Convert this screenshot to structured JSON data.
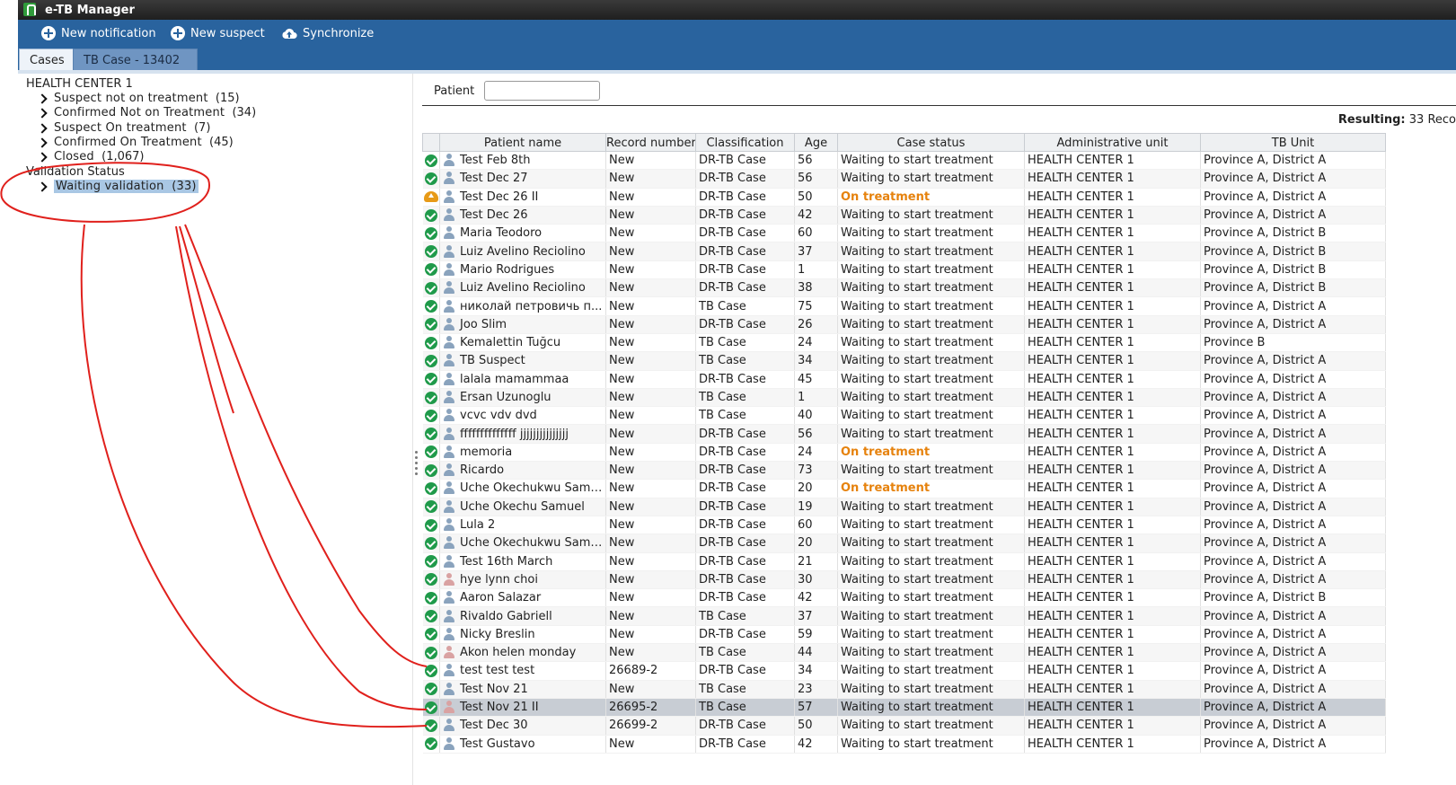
{
  "window": {
    "title": "e-TB Manager"
  },
  "toolbar": {
    "new_notification": "New notification",
    "new_suspect": "New suspect",
    "synchronize": "Synchronize"
  },
  "tabs": [
    {
      "label": "Cases",
      "active": true
    },
    {
      "label": "TB Case - 13402",
      "active": false
    }
  ],
  "tree": {
    "root": "HEALTH CENTER 1",
    "items": [
      {
        "label": "Suspect not on treatment",
        "count": "(15)"
      },
      {
        "label": "Confirmed Not on Treatment",
        "count": "(34)"
      },
      {
        "label": "Suspect On treatment",
        "count": "(7)"
      },
      {
        "label": "Confirmed On Treatment",
        "count": "(45)"
      },
      {
        "label": "Closed",
        "count": "(1,067)"
      }
    ],
    "group": "Validation Status",
    "group_items": [
      {
        "label": "Waiting validation",
        "count": "(33)",
        "selected": true
      }
    ]
  },
  "search": {
    "label": "Patient",
    "value": ""
  },
  "resulting": {
    "label": "Resulting:",
    "value": "33 Reco"
  },
  "grid": {
    "columns": [
      "",
      "Patient name",
      "Record number",
      "Classification",
      "Age",
      "Case status",
      "Administrative unit",
      "TB Unit"
    ],
    "rows": [
      {
        "icon": "check-icon",
        "gender": "male",
        "name": "Test Feb 8th",
        "record": "New",
        "classification": "DR-TB Case",
        "age": "56",
        "status": "Waiting to start treatment",
        "admin_unit": "HEALTH CENTER 1",
        "tb_unit": "Province A, District A"
      },
      {
        "icon": "check-icon",
        "gender": "male",
        "name": "Test Dec 27",
        "record": "New",
        "classification": "DR-TB Case",
        "age": "56",
        "status": "Waiting to start treatment",
        "admin_unit": "HEALTH CENTER 1",
        "tb_unit": "Province A, District A"
      },
      {
        "icon": "upload-icon",
        "gender": "male",
        "name": "Test Dec 26 II",
        "record": "New",
        "classification": "DR-TB Case",
        "age": "50",
        "status": "On treatment",
        "admin_unit": "HEALTH CENTER 1",
        "tb_unit": "Province A, District A"
      },
      {
        "icon": "check-icon",
        "gender": "male",
        "name": "Test Dec 26",
        "record": "New",
        "classification": "DR-TB Case",
        "age": "42",
        "status": "Waiting to start treatment",
        "admin_unit": "HEALTH CENTER 1",
        "tb_unit": "Province A, District A"
      },
      {
        "icon": "check-icon",
        "gender": "male",
        "name": "Maria Teodoro",
        "record": "New",
        "classification": "DR-TB Case",
        "age": "60",
        "status": "Waiting to start treatment",
        "admin_unit": "HEALTH CENTER 1",
        "tb_unit": "Province A, District B"
      },
      {
        "icon": "check-icon",
        "gender": "male",
        "name": "Luiz Avelino Reciolino",
        "record": "New",
        "classification": "DR-TB Case",
        "age": "37",
        "status": "Waiting to start treatment",
        "admin_unit": "HEALTH CENTER 1",
        "tb_unit": "Province A, District B"
      },
      {
        "icon": "check-icon",
        "gender": "male",
        "name": "Mario Rodrigues",
        "record": "New",
        "classification": "DR-TB Case",
        "age": "1",
        "status": "Waiting to start treatment",
        "admin_unit": "HEALTH CENTER 1",
        "tb_unit": "Province A, District B"
      },
      {
        "icon": "check-icon",
        "gender": "male",
        "name": "Luiz Avelino Reciolino",
        "record": "New",
        "classification": "DR-TB Case",
        "age": "38",
        "status": "Waiting to start treatment",
        "admin_unit": "HEALTH CENTER 1",
        "tb_unit": "Province A, District B"
      },
      {
        "icon": "check-icon",
        "gender": "male",
        "name": "николай петровичь п...",
        "record": "New",
        "classification": "TB Case",
        "age": "75",
        "status": "Waiting to start treatment",
        "admin_unit": "HEALTH CENTER 1",
        "tb_unit": "Province A, District A"
      },
      {
        "icon": "check-icon",
        "gender": "male",
        "name": "Joo Slim",
        "record": "New",
        "classification": "DR-TB Case",
        "age": "26",
        "status": "Waiting to start treatment",
        "admin_unit": "HEALTH CENTER 1",
        "tb_unit": "Province A, District A"
      },
      {
        "icon": "check-icon",
        "gender": "male",
        "name": "Kemalettin Tuğcu",
        "record": "New",
        "classification": "TB Case",
        "age": "24",
        "status": "Waiting to start treatment",
        "admin_unit": "HEALTH CENTER 1",
        "tb_unit": "Province B"
      },
      {
        "icon": "check-icon",
        "gender": "male",
        "name": "TB Suspect",
        "record": "New",
        "classification": "TB Case",
        "age": "34",
        "status": "Waiting to start treatment",
        "admin_unit": "HEALTH CENTER 1",
        "tb_unit": "Province A, District A"
      },
      {
        "icon": "check-icon",
        "gender": "male",
        "name": "lalala mamammaa",
        "record": "New",
        "classification": "DR-TB Case",
        "age": "45",
        "status": "Waiting to start treatment",
        "admin_unit": "HEALTH CENTER 1",
        "tb_unit": "Province A, District A"
      },
      {
        "icon": "check-icon",
        "gender": "male",
        "name": "Ersan Uzunoglu",
        "record": "New",
        "classification": "TB Case",
        "age": "1",
        "status": "Waiting to start treatment",
        "admin_unit": "HEALTH CENTER 1",
        "tb_unit": "Province A, District A"
      },
      {
        "icon": "check-icon",
        "gender": "male",
        "name": "vcvc vdv dvd",
        "record": "New",
        "classification": "TB Case",
        "age": "40",
        "status": "Waiting to start treatment",
        "admin_unit": "HEALTH CENTER 1",
        "tb_unit": "Province A, District A"
      },
      {
        "icon": "check-icon",
        "gender": "male",
        "name": "ffffffffffffff jjjjjjjjjjjjjjj",
        "record": "New",
        "classification": "DR-TB Case",
        "age": "56",
        "status": "Waiting to start treatment",
        "admin_unit": "HEALTH CENTER 1",
        "tb_unit": "Province A, District A"
      },
      {
        "icon": "check-icon",
        "gender": "male",
        "name": "memoria",
        "record": "New",
        "classification": "DR-TB Case",
        "age": "24",
        "status": "On treatment",
        "admin_unit": "HEALTH CENTER 1",
        "tb_unit": "Province A, District A"
      },
      {
        "icon": "check-icon",
        "gender": "male",
        "name": "Ricardo",
        "record": "New",
        "classification": "DR-TB Case",
        "age": "73",
        "status": "Waiting to start treatment",
        "admin_unit": "HEALTH CENTER 1",
        "tb_unit": "Province A, District A"
      },
      {
        "icon": "check-icon",
        "gender": "male",
        "name": "Uche Okechukwu Samuel",
        "record": "New",
        "classification": "DR-TB Case",
        "age": "20",
        "status": "On treatment",
        "admin_unit": "HEALTH CENTER 1",
        "tb_unit": "Province A, District A"
      },
      {
        "icon": "check-icon",
        "gender": "male",
        "name": "Uche Okechu Samuel",
        "record": "New",
        "classification": "DR-TB Case",
        "age": "19",
        "status": "Waiting to start treatment",
        "admin_unit": "HEALTH CENTER 1",
        "tb_unit": "Province A, District A"
      },
      {
        "icon": "check-icon",
        "gender": "male",
        "name": "Lula 2",
        "record": "New",
        "classification": "DR-TB Case",
        "age": "60",
        "status": "Waiting to start treatment",
        "admin_unit": "HEALTH CENTER 1",
        "tb_unit": "Province A, District A"
      },
      {
        "icon": "check-icon",
        "gender": "male",
        "name": "Uche Okechukwu Samuel",
        "record": "New",
        "classification": "DR-TB Case",
        "age": "20",
        "status": "Waiting to start treatment",
        "admin_unit": "HEALTH CENTER 1",
        "tb_unit": "Province A, District A"
      },
      {
        "icon": "check-icon",
        "gender": "male",
        "name": "Test 16th March",
        "record": "New",
        "classification": "DR-TB Case",
        "age": "21",
        "status": "Waiting to start treatment",
        "admin_unit": "HEALTH CENTER 1",
        "tb_unit": "Province A, District A"
      },
      {
        "icon": "check-icon",
        "gender": "female",
        "name": "hye lynn choi",
        "record": "New",
        "classification": "DR-TB Case",
        "age": "30",
        "status": "Waiting to start treatment",
        "admin_unit": "HEALTH CENTER 1",
        "tb_unit": "Province A, District A"
      },
      {
        "icon": "check-icon",
        "gender": "male",
        "name": "Aaron Salazar",
        "record": "New",
        "classification": "DR-TB Case",
        "age": "42",
        "status": "Waiting to start treatment",
        "admin_unit": "HEALTH CENTER 1",
        "tb_unit": "Province A, District B"
      },
      {
        "icon": "check-icon",
        "gender": "male",
        "name": "Rivaldo Gabriell",
        "record": "New",
        "classification": "TB Case",
        "age": "37",
        "status": "Waiting to start treatment",
        "admin_unit": "HEALTH CENTER 1",
        "tb_unit": "Province A, District A"
      },
      {
        "icon": "check-icon",
        "gender": "male",
        "name": "Nicky Breslin",
        "record": "New",
        "classification": "DR-TB Case",
        "age": "59",
        "status": "Waiting to start treatment",
        "admin_unit": "HEALTH CENTER 1",
        "tb_unit": "Province A, District A"
      },
      {
        "icon": "check-icon",
        "gender": "female",
        "name": "Akon helen monday",
        "record": "New",
        "classification": "TB Case",
        "age": "44",
        "status": "Waiting to start treatment",
        "admin_unit": "HEALTH CENTER 1",
        "tb_unit": "Province A, District A"
      },
      {
        "icon": "check-icon",
        "gender": "male",
        "name": "test test test",
        "record": "26689-2",
        "classification": "DR-TB Case",
        "age": "34",
        "status": "Waiting to start treatment",
        "admin_unit": "HEALTH CENTER 1",
        "tb_unit": "Province A, District A"
      },
      {
        "icon": "check-icon",
        "gender": "male",
        "name": "Test Nov 21",
        "record": "New",
        "classification": "TB Case",
        "age": "23",
        "status": "Waiting to start treatment",
        "admin_unit": "HEALTH CENTER 1",
        "tb_unit": "Province A, District A"
      },
      {
        "icon": "check-icon",
        "gender": "female",
        "name": "Test Nov 21 II",
        "record": "26695-2",
        "classification": "TB Case",
        "age": "57",
        "status": "Waiting to start treatment",
        "admin_unit": "HEALTH CENTER 1",
        "tb_unit": "Province A, District A",
        "selected": true
      },
      {
        "icon": "check-icon",
        "gender": "male",
        "name": "Test Dec 30",
        "record": "26699-2",
        "classification": "DR-TB Case",
        "age": "50",
        "status": "Waiting to start treatment",
        "admin_unit": "HEALTH CENTER 1",
        "tb_unit": "Province A, District A"
      },
      {
        "icon": "check-icon",
        "gender": "male",
        "name": "Test Gustavo",
        "record": "New",
        "classification": "DR-TB Case",
        "age": "42",
        "status": "Waiting to start treatment",
        "admin_unit": "HEALTH CENTER 1",
        "tb_unit": "Province A, District A"
      }
    ]
  },
  "colors": {
    "toolbar": "#29639e",
    "on_treatment": "#e6820d",
    "valid_check": "#1f9a4a",
    "annotation": "#e0201c"
  }
}
